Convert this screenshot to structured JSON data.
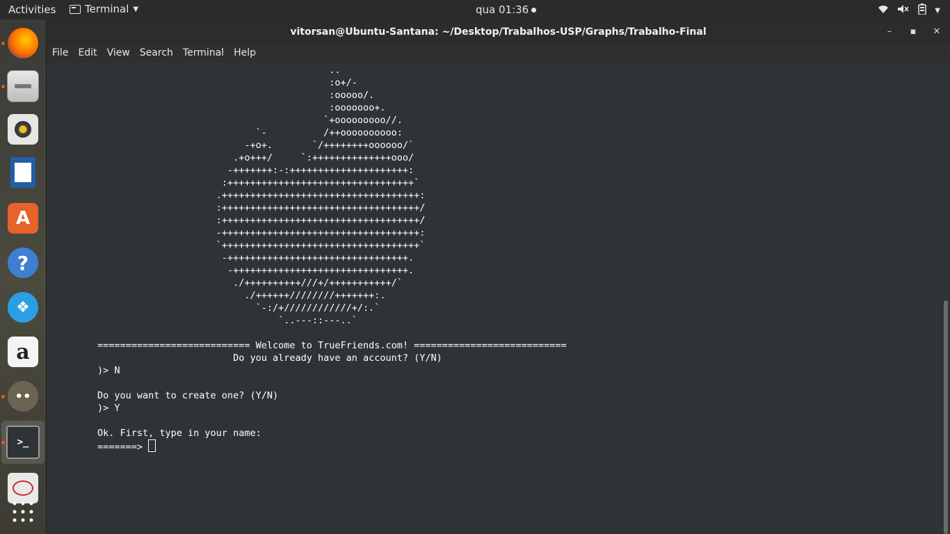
{
  "topbar": {
    "activities": "Activities",
    "app_name": "Terminal",
    "clock": "qua 01:36"
  },
  "dock": {
    "items": [
      "Firefox",
      "Files",
      "Rhythmbox",
      "LibreOffice Writer",
      "Ubuntu Software",
      "Help",
      "Dropbox",
      "Amazon",
      "GIMP",
      "Terminal",
      "Remmina",
      "Show Applications"
    ]
  },
  "window": {
    "title": "vitorsan@Ubuntu-Santana: ~/Desktop/Trabalhos-USP/Graphs/Trabalho-Final",
    "menu": [
      "File",
      "Edit",
      "View",
      "Search",
      "Terminal",
      "Help"
    ]
  },
  "terminal": {
    "art": [
      "                                         ..",
      "                                         :o+/-",
      "                                         :ooooo/.",
      "                                         :ooooooo+.",
      "                                        `+ooooooooo//.",
      "                            `-          /++oooooooooo:",
      "                          -+o+.       `/++++++++oooooo/`",
      "                        .+o+++/     `:++++++++++++++ooo/",
      "                       -+++++++:-:+++++++++++++++++++++:",
      "                      :+++++++++++++++++++++++++++++++++`",
      "                     .+++++++++++++++++++++++++++++++++++:",
      "                     :+++++++++++++++++++++++++++++++++++/",
      "                     :+++++++++++++++++++++++++++++++++++/",
      "                     -+++++++++++++++++++++++++++++++++++:",
      "                     `+++++++++++++++++++++++++++++++++++`",
      "                      -++++++++++++++++++++++++++++++++.",
      "                       -+++++++++++++++++++++++++++++++.",
      "                        ./++++++++++///+/+++++++++++/`",
      "                          ./++++++////////+++++++:.",
      "                            `-:/+////////////+/:.`",
      "                                `..---::---..`"
    ],
    "lines": [
      "",
      "=========================== Welcome to TrueFriends.com! ===========================",
      "                        Do you already have an account? (Y/N)",
      ")> N",
      "",
      "Do you want to create one? (Y/N)",
      ")> Y",
      "",
      "Ok. First, type in your name:"
    ],
    "prompt": "=======> "
  }
}
